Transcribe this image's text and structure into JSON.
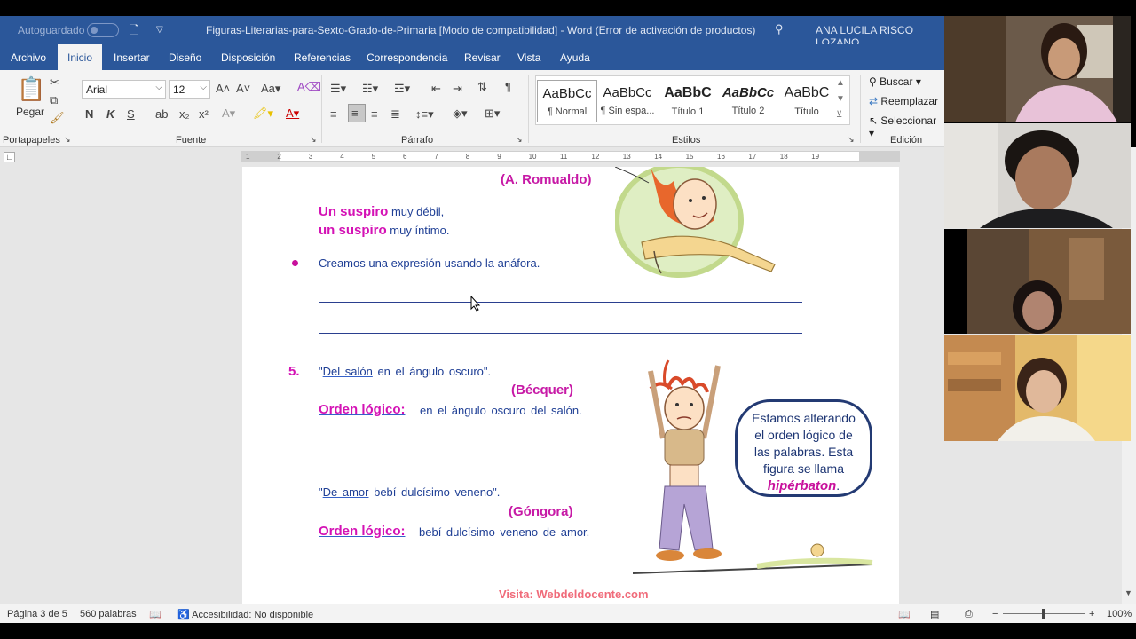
{
  "titlebar": {
    "autosave_label": "Autoguardado",
    "document_title": "Figuras-Literarias-para-Sexto-Grado-de-Primaria [Modo de compatibilidad]  -  Word (Error de activación de productos)",
    "user_name": "ANA LUCILA RISCO LOZANO"
  },
  "tabs": [
    "Archivo",
    "Inicio",
    "Insertar",
    "Diseño",
    "Disposición",
    "Referencias",
    "Correspondencia",
    "Revisar",
    "Vista",
    "Ayuda"
  ],
  "active_tab": "Inicio",
  "ribbon": {
    "paste_label": "Pegar",
    "font_name": "Arial",
    "font_size": "12",
    "groups": {
      "clipboard": "Portapapeles",
      "font": "Fuente",
      "paragraph": "Párrafo",
      "styles": "Estilos",
      "editing": "Edición"
    },
    "format_buttons": {
      "bold": "N",
      "italic": "K",
      "underline": "S",
      "strike": "ab",
      "subscript": "x₂",
      "superscript": "x²"
    },
    "styles": [
      {
        "sample": "AaBbCc",
        "name": "¶ Normal"
      },
      {
        "sample": "AaBbCc",
        "name": "¶ Sin espa..."
      },
      {
        "sample": "AaBbC",
        "name": "Título 1"
      },
      {
        "sample": "AaBbCc",
        "name": "Título 2"
      },
      {
        "sample": "AaBbC",
        "name": "Título"
      }
    ],
    "editing": {
      "find": "Buscar",
      "replace": "Reemplazar",
      "select": "Seleccionar"
    }
  },
  "ruler": {
    "ticks": [
      "1",
      "2",
      "3",
      "4",
      "5",
      "6",
      "7",
      "8",
      "9",
      "10",
      "11",
      "12",
      "13",
      "14",
      "15",
      "16",
      "17",
      "18",
      "19"
    ]
  },
  "document": {
    "author1": "(A. Romualdo)",
    "line1_strong": "Un suspiro",
    "line1_rest": " muy débil,",
    "line2_strong": "un suspiro",
    "line2_rest": " muy íntimo.",
    "bullet_text": "Creamos una expresión usando la anáfora.",
    "item_number": "5.",
    "quote1_a": "\"",
    "quote1_link": "Del salón",
    "quote1_b": " en el ángulo oscuro\".",
    "author2": "(Bécquer)",
    "orden_label": "Orden lógico:",
    "orden1_text": "en el ángulo oscuro del salón.",
    "quote2_a": "\"",
    "quote2_link": "De amor",
    "quote2_b": " bebí dulcísimo veneno\".",
    "author3": "(Góngora)",
    "orden2_text": "bebí dulcísimo veneno de amor.",
    "bubble_line1": "Estamos alterando",
    "bubble_line2": "el orden lógico de",
    "bubble_line3": "las palabras. Esta",
    "bubble_line4": "figura se llama",
    "bubble_term": "hipérbaton",
    "bubble_period": ".",
    "footer": "Visita: Webdeldocente.com"
  },
  "status": {
    "page": "Página 3 de 5",
    "words": "560 palabras",
    "accessibility": "Accesibilidad: No disponible",
    "zoom": "100%"
  },
  "colors": {
    "word_blue": "#2b579a",
    "ribbon_bg": "#f3f3f3",
    "doc_text": "#1f3f95",
    "magenta": "#d412b5"
  }
}
